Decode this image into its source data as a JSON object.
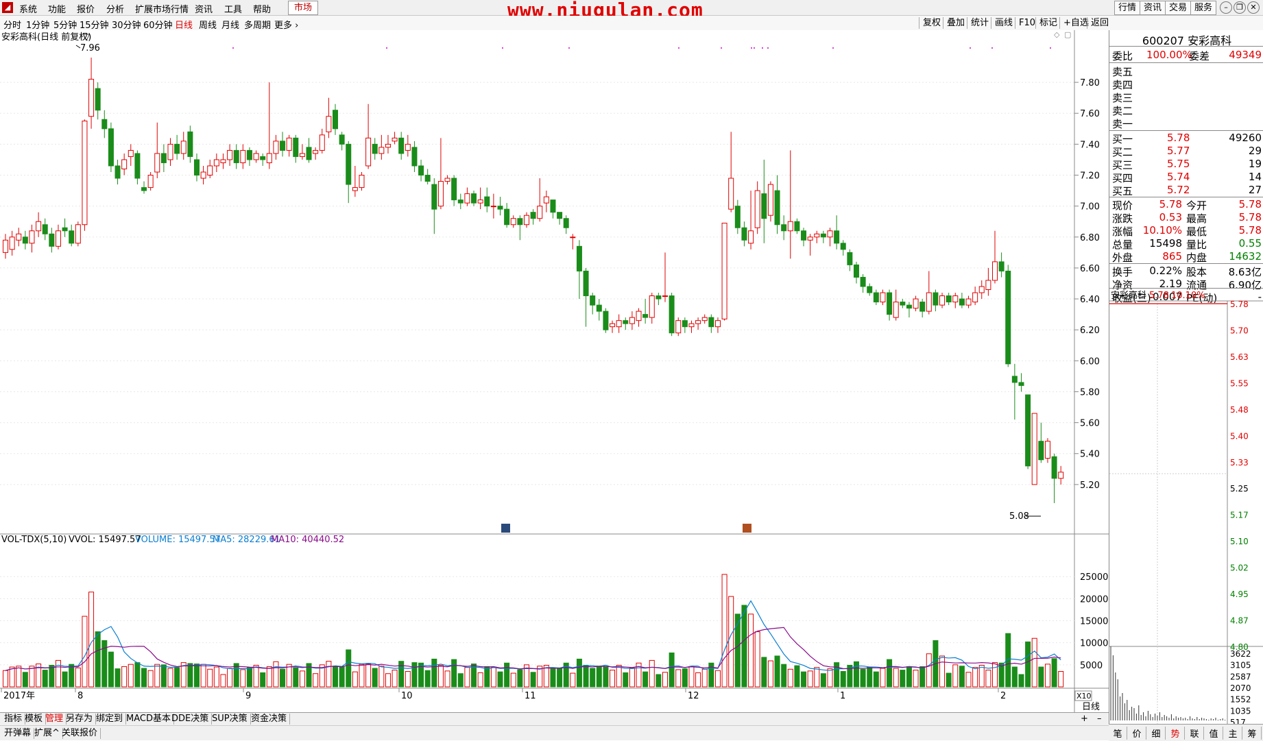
{
  "menu": {
    "items": [
      "系统",
      "功能",
      "报价",
      "分析",
      "扩展市场行情",
      "资讯",
      "工具",
      "帮助"
    ],
    "market_tab": "市场",
    "watermark": "www.niugulan.com",
    "right_buttons": [
      "行情",
      "资讯",
      "交易",
      "服务"
    ]
  },
  "periods": {
    "items": [
      "分时",
      "1分钟",
      "5分钟",
      "15分钟",
      "30分钟",
      "60分钟",
      "日线",
      "周线",
      "月线",
      "多周期",
      "更多"
    ],
    "active": "日线",
    "tools": [
      "复权",
      "叠加",
      "统计",
      "画线",
      "F10",
      "标记",
      "+自选",
      "返回"
    ]
  },
  "chart_title": "安彩高科(日线 前复权)",
  "kline": {
    "price_ticks": [
      "7.80",
      "7.60",
      "7.40",
      "7.20",
      "7.00",
      "6.80",
      "6.60",
      "6.40",
      "6.20",
      "6.00",
      "5.80",
      "5.60",
      "5.40",
      "5.20"
    ],
    "high_label": "7.96",
    "low_label": "5.08"
  },
  "chart_data": {
    "type": "candlestick",
    "ylim": [
      5.0,
      7.96
    ],
    "candles": [
      [
        6.7,
        6.78,
        6.66,
        6.82
      ],
      [
        6.72,
        6.8,
        6.68,
        6.84
      ],
      [
        6.78,
        6.82,
        6.74,
        6.86
      ],
      [
        6.8,
        6.76,
        6.72,
        6.84
      ],
      [
        6.76,
        6.84,
        6.7,
        6.88
      ],
      [
        6.84,
        6.9,
        6.8,
        6.96
      ],
      [
        6.88,
        6.82,
        6.78,
        6.92
      ],
      [
        6.82,
        6.74,
        6.7,
        6.86
      ],
      [
        6.74,
        6.84,
        6.72,
        6.88
      ],
      [
        6.86,
        6.84,
        6.8,
        6.92
      ],
      [
        6.84,
        6.76,
        6.74,
        6.88
      ],
      [
        6.76,
        6.88,
        6.74,
        6.9
      ],
      [
        6.88,
        7.55,
        6.84,
        7.56
      ],
      [
        7.58,
        7.82,
        7.5,
        7.96
      ],
      [
        7.76,
        7.62,
        7.56,
        7.8
      ],
      [
        7.56,
        7.5,
        7.44,
        7.62
      ],
      [
        7.5,
        7.26,
        7.22,
        7.54
      ],
      [
        7.26,
        7.18,
        7.14,
        7.3
      ],
      [
        7.24,
        7.3,
        7.2,
        7.34
      ],
      [
        7.32,
        7.36,
        7.26,
        7.4
      ],
      [
        7.34,
        7.18,
        7.14,
        7.36
      ],
      [
        7.12,
        7.1,
        7.08,
        7.16
      ],
      [
        7.12,
        7.2,
        7.1,
        7.22
      ],
      [
        7.22,
        7.34,
        7.18,
        7.54
      ],
      [
        7.34,
        7.28,
        7.22,
        7.4
      ],
      [
        7.3,
        7.4,
        7.26,
        7.44
      ],
      [
        7.4,
        7.34,
        7.3,
        7.46
      ],
      [
        7.34,
        7.42,
        7.3,
        7.48
      ],
      [
        7.48,
        7.32,
        7.28,
        7.52
      ],
      [
        7.3,
        7.2,
        7.16,
        7.34
      ],
      [
        7.18,
        7.22,
        7.14,
        7.26
      ],
      [
        7.2,
        7.26,
        7.18,
        7.3
      ],
      [
        7.26,
        7.3,
        7.22,
        7.34
      ],
      [
        7.28,
        7.3,
        7.24,
        7.34
      ],
      [
        7.3,
        7.36,
        7.26,
        7.4
      ],
      [
        7.36,
        7.28,
        7.24,
        7.4
      ],
      [
        7.28,
        7.36,
        7.24,
        7.4
      ],
      [
        7.36,
        7.3,
        7.26,
        7.38
      ],
      [
        7.3,
        7.34,
        7.28,
        7.36
      ],
      [
        7.32,
        7.3,
        7.26,
        7.34
      ],
      [
        7.28,
        7.34,
        7.24,
        7.8
      ],
      [
        7.34,
        7.42,
        7.3,
        7.46
      ],
      [
        7.42,
        7.36,
        7.32,
        7.48
      ],
      [
        7.36,
        7.44,
        7.32,
        7.46
      ],
      [
        7.44,
        7.32,
        7.28,
        7.46
      ],
      [
        7.32,
        7.34,
        7.3,
        7.4
      ],
      [
        7.38,
        7.3,
        7.28,
        7.44
      ],
      [
        7.34,
        7.36,
        7.3,
        7.38
      ],
      [
        7.36,
        7.46,
        7.34,
        7.5
      ],
      [
        7.48,
        7.58,
        7.44,
        7.7
      ],
      [
        7.62,
        7.5,
        7.46,
        7.66
      ],
      [
        7.46,
        7.4,
        7.36,
        7.48
      ],
      [
        7.4,
        7.14,
        7.02,
        7.42
      ],
      [
        7.1,
        7.12,
        7.06,
        7.26
      ],
      [
        7.12,
        7.2,
        7.1,
        7.22
      ],
      [
        7.26,
        7.44,
        7.24,
        7.66
      ],
      [
        7.4,
        7.34,
        7.3,
        7.44
      ],
      [
        7.34,
        7.38,
        7.3,
        7.46
      ],
      [
        7.38,
        7.4,
        7.34,
        7.46
      ],
      [
        7.42,
        7.44,
        7.4,
        7.48
      ],
      [
        7.44,
        7.34,
        7.3,
        7.48
      ],
      [
        7.36,
        7.4,
        7.32,
        7.46
      ],
      [
        7.38,
        7.26,
        7.22,
        7.42
      ],
      [
        7.26,
        7.2,
        7.16,
        7.3
      ],
      [
        7.2,
        7.16,
        7.14,
        7.24
      ],
      [
        7.14,
        6.98,
        6.82,
        7.18
      ],
      [
        7.0,
        7.16,
        6.98,
        7.44
      ],
      [
        7.16,
        7.18,
        7.14,
        7.2
      ],
      [
        7.18,
        7.04,
        7.0,
        7.2
      ],
      [
        7.04,
        7.02,
        6.98,
        7.08
      ],
      [
        7.02,
        7.08,
        7.0,
        7.12
      ],
      [
        7.08,
        7.02,
        7.0,
        7.1
      ],
      [
        7.02,
        7.04,
        6.98,
        7.12
      ],
      [
        7.06,
        7.0,
        6.96,
        7.12
      ],
      [
        7.0,
        7.0,
        6.92,
        7.08
      ],
      [
        7.0,
        6.98,
        6.94,
        7.06
      ],
      [
        6.98,
        6.88,
        6.86,
        7.02
      ],
      [
        6.88,
        6.92,
        6.86,
        6.94
      ],
      [
        6.92,
        6.88,
        6.78,
        6.94
      ],
      [
        6.88,
        6.94,
        6.86,
        6.96
      ],
      [
        6.96,
        6.92,
        6.88,
        6.98
      ],
      [
        6.92,
        7.0,
        6.9,
        7.18
      ],
      [
        7.02,
        7.06,
        6.96,
        7.1
      ],
      [
        7.04,
        6.96,
        6.92,
        7.04
      ],
      [
        6.96,
        6.92,
        6.88,
        6.96
      ],
      [
        6.92,
        6.86,
        6.82,
        6.94
      ],
      [
        6.8,
        6.8,
        6.72,
        6.82
      ],
      [
        6.74,
        6.58,
        6.4,
        6.78
      ],
      [
        6.58,
        6.42,
        6.22,
        6.6
      ],
      [
        6.42,
        6.36,
        6.3,
        6.44
      ],
      [
        6.36,
        6.32,
        6.26,
        6.4
      ],
      [
        6.32,
        6.2,
        6.18,
        6.34
      ],
      [
        6.22,
        6.24,
        6.18,
        6.26
      ],
      [
        6.22,
        6.26,
        6.18,
        6.3
      ],
      [
        6.26,
        6.24,
        6.2,
        6.28
      ],
      [
        6.24,
        6.28,
        6.2,
        6.32
      ],
      [
        6.26,
        6.32,
        6.22,
        6.34
      ],
      [
        6.3,
        6.28,
        6.24,
        6.4
      ],
      [
        6.28,
        6.42,
        6.24,
        6.44
      ],
      [
        6.42,
        6.4,
        6.36,
        6.44
      ],
      [
        6.42,
        6.42,
        6.38,
        6.7
      ],
      [
        6.42,
        6.18,
        6.16,
        6.44
      ],
      [
        6.18,
        6.26,
        6.16,
        6.28
      ],
      [
        6.26,
        6.22,
        6.18,
        6.28
      ],
      [
        6.22,
        6.24,
        6.18,
        6.26
      ],
      [
        6.24,
        6.26,
        6.2,
        6.28
      ],
      [
        6.26,
        6.28,
        6.24,
        6.3
      ],
      [
        6.28,
        6.22,
        6.18,
        6.3
      ],
      [
        6.22,
        6.26,
        6.18,
        6.28
      ],
      [
        6.27,
        6.89,
        6.26,
        6.89
      ],
      [
        6.98,
        7.18,
        6.96,
        7.48
      ],
      [
        7.0,
        6.86,
        6.82,
        7.04
      ],
      [
        6.86,
        6.78,
        6.74,
        6.9
      ],
      [
        6.76,
        6.84,
        6.72,
        7.1
      ],
      [
        6.86,
        7.1,
        6.82,
        7.16
      ],
      [
        7.08,
        6.92,
        6.76,
        7.3
      ],
      [
        6.94,
        7.14,
        6.9,
        7.16
      ],
      [
        7.1,
        6.88,
        6.82,
        7.2
      ],
      [
        6.88,
        6.84,
        6.78,
        6.94
      ],
      [
        6.84,
        6.9,
        6.66,
        7.36
      ],
      [
        6.9,
        6.84,
        6.82,
        6.92
      ],
      [
        6.84,
        6.78,
        6.74,
        6.86
      ],
      [
        6.78,
        6.8,
        6.68,
        6.82
      ],
      [
        6.8,
        6.82,
        6.76,
        6.84
      ],
      [
        6.82,
        6.8,
        6.76,
        6.84
      ],
      [
        6.8,
        6.84,
        6.74,
        6.86
      ],
      [
        6.84,
        6.76,
        6.72,
        6.94
      ],
      [
        6.76,
        6.72,
        6.68,
        6.78
      ],
      [
        6.7,
        6.62,
        6.58,
        6.72
      ],
      [
        6.62,
        6.54,
        6.5,
        6.64
      ],
      [
        6.54,
        6.48,
        6.44,
        6.56
      ],
      [
        6.48,
        6.44,
        6.42,
        6.5
      ],
      [
        6.44,
        6.38,
        6.36,
        6.46
      ],
      [
        6.38,
        6.44,
        6.36,
        6.46
      ],
      [
        6.44,
        6.3,
        6.26,
        6.46
      ],
      [
        6.28,
        6.38,
        6.26,
        6.46
      ],
      [
        6.38,
        6.36,
        6.34,
        6.4
      ],
      [
        6.36,
        6.34,
        6.28,
        6.38
      ],
      [
        6.34,
        6.4,
        6.32,
        6.42
      ],
      [
        6.38,
        6.32,
        6.28,
        6.4
      ],
      [
        6.32,
        6.44,
        6.3,
        6.58
      ],
      [
        6.44,
        6.36,
        6.32,
        6.46
      ],
      [
        6.36,
        6.42,
        6.34,
        6.44
      ],
      [
        6.42,
        6.38,
        6.36,
        6.44
      ],
      [
        6.38,
        6.42,
        6.34,
        6.44
      ],
      [
        6.4,
        6.36,
        6.34,
        6.44
      ],
      [
        6.36,
        6.4,
        6.34,
        6.42
      ],
      [
        6.38,
        6.44,
        6.36,
        6.48
      ],
      [
        6.44,
        6.48,
        6.4,
        6.52
      ],
      [
        6.46,
        6.52,
        6.42,
        6.6
      ],
      [
        6.52,
        6.64,
        6.5,
        6.84
      ],
      [
        6.64,
        6.58,
        6.54,
        6.7
      ],
      [
        6.58,
        5.98,
        5.96,
        6.62
      ],
      [
        5.9,
        5.86,
        5.62,
        5.98
      ],
      [
        5.86,
        5.84,
        5.8,
        5.92
      ],
      [
        5.78,
        5.32,
        5.3,
        5.78
      ],
      [
        5.2,
        5.66,
        5.2,
        5.66
      ],
      [
        5.48,
        5.36,
        5.34,
        5.6
      ],
      [
        5.37,
        5.48,
        5.34,
        5.5
      ],
      [
        5.38,
        5.24,
        5.08,
        5.4
      ],
      [
        5.24,
        5.28,
        5.2,
        5.32
      ]
    ]
  },
  "volume": {
    "title": "VOL-TDX(5,10)",
    "vvol_label": "VVOL: 15497.57",
    "volume_label": "VOLUME: 15497.57",
    "ma5_label": "MA5: 28229.61",
    "ma10_label": "MA10: 40440.52",
    "ticks": [
      "25000",
      "20000",
      "15000",
      "10000",
      "5000"
    ],
    "multiplier": "X10"
  },
  "date_axis": {
    "labels": [
      "2017年",
      "8",
      "9",
      "10",
      "11",
      "12",
      "1",
      "2"
    ],
    "period_label": "日线"
  },
  "quote": {
    "code_name": "600207 安彩高科",
    "weibi_label": "委比",
    "weibi_value": "100.00%",
    "weicha_label": "委差",
    "weicha_value": "49349",
    "sell_labels": [
      "卖五",
      "卖四",
      "卖三",
      "卖二",
      "卖一"
    ],
    "buy": [
      {
        "label": "买一",
        "price": "5.78",
        "vol": "49260"
      },
      {
        "label": "买二",
        "price": "5.77",
        "vol": "29"
      },
      {
        "label": "买三",
        "price": "5.75",
        "vol": "19"
      },
      {
        "label": "买四",
        "price": "5.74",
        "vol": "14"
      },
      {
        "label": "买五",
        "price": "5.72",
        "vol": "27"
      }
    ],
    "stats": [
      {
        "l1": "现价",
        "v1": "5.78",
        "c1": "red",
        "l2": "今开",
        "v2": "5.78",
        "c2": "red"
      },
      {
        "l1": "涨跌",
        "v1": "0.53",
        "c1": "red",
        "l2": "最高",
        "v2": "5.78",
        "c2": "red"
      },
      {
        "l1": "涨幅",
        "v1": "10.10%",
        "c1": "red",
        "l2": "最低",
        "v2": "5.78",
        "c2": "red"
      },
      {
        "l1": "总量",
        "v1": "15498",
        "c1": "black",
        "l2": "量比",
        "v2": "0.55",
        "c2": "green"
      },
      {
        "l1": "外盘",
        "v1": "865",
        "c1": "red",
        "l2": "内盘",
        "v2": "14632",
        "c2": "green"
      }
    ],
    "stats2": [
      {
        "l1": "换手",
        "v1": "0.22%",
        "l2": "股本",
        "v2": "8.63亿"
      },
      {
        "l1": "净资",
        "v1": "2.19",
        "l2": "流通",
        "v2": "6.90亿"
      },
      {
        "l1": "收益(三)",
        "v1": "-0.007",
        "l2": "PE(动)",
        "v2": "-"
      }
    ]
  },
  "intraday": {
    "name": "安彩高科",
    "price": "5.78",
    "pct": "10.10%",
    "price_ticks": [
      "5.78",
      "5.70",
      "5.63",
      "5.55",
      "5.48",
      "5.40",
      "5.33",
      "5.25",
      "5.17",
      "5.10",
      "5.02",
      "4.95",
      "4.87",
      "4.80"
    ],
    "vol_ticks": [
      "3622",
      "3105",
      "2587",
      "2070",
      "1552",
      "1035",
      "517"
    ]
  },
  "bottom_tabs": [
    "指标",
    "模板",
    "管理",
    "另存为",
    "绑定到",
    "MACD基本",
    "DDE决策",
    "SUP决策",
    "资金决策"
  ],
  "bottom_tabs2": [
    "开弹幕",
    "扩展^",
    "关联报价"
  ],
  "right_tabs": [
    "笔",
    "价",
    "细",
    "势",
    "联",
    "值",
    "主",
    "筹"
  ],
  "colors": {
    "up": "#e00000",
    "down": "#1a8c1a",
    "ma5": "#0a7fd4",
    "ma10": "#8b0a8b"
  }
}
